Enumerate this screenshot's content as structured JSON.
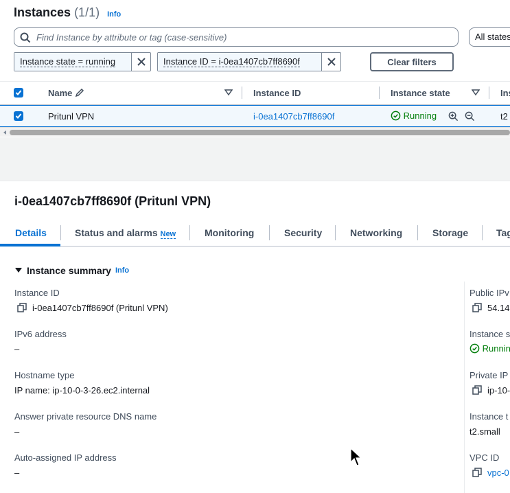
{
  "header": {
    "title": "Instances",
    "count": "(1/1)",
    "info": "Info",
    "search_placeholder": "Find Instance by attribute or tag (case-sensitive)",
    "state_select": "All states",
    "filters": [
      {
        "label": "Instance state = running"
      },
      {
        "label": "Instance ID = i-0ea1407cb7ff8690f"
      }
    ],
    "clear_filters": "Clear filters"
  },
  "table": {
    "columns": [
      "Name",
      "Instance ID",
      "Instance state",
      "Ins"
    ],
    "row": {
      "name": "Pritunl VPN",
      "instance_id": "i-0ea1407cb7ff8690f",
      "state": "Running",
      "type_partial": "t2"
    }
  },
  "detail": {
    "title": "i-0ea1407cb7ff8690f (Pritunl VPN)",
    "tabs": [
      "Details",
      "Status and alarms",
      "Monitoring",
      "Security",
      "Networking",
      "Storage",
      "Tag"
    ],
    "new_badge": "New",
    "summary_heading": "Instance summary",
    "summary_info": "Info",
    "left_fields": [
      {
        "label": "Instance ID",
        "value": "i-0ea1407cb7ff8690f (Pritunl VPN)"
      },
      {
        "label": "IPv6 address",
        "value": "–"
      },
      {
        "label": "Hostname type",
        "value": "IP name: ip-10-0-3-26.ec2.internal"
      },
      {
        "label": "Answer private resource DNS name",
        "value": "–"
      },
      {
        "label": "Auto-assigned IP address",
        "value": "–"
      }
    ],
    "right_fields": [
      {
        "label": "Public IPv",
        "value": "54.14"
      },
      {
        "label": "Instance s",
        "value": "Runnin"
      },
      {
        "label": "Private IP",
        "value": "ip-10-"
      },
      {
        "label": "Instance t",
        "value": "t2.small"
      },
      {
        "label": "VPC ID",
        "value": "vpc-0"
      }
    ]
  },
  "colors": {
    "accent": "#0972d3",
    "running": "#037f0c",
    "text": "#16191f"
  }
}
